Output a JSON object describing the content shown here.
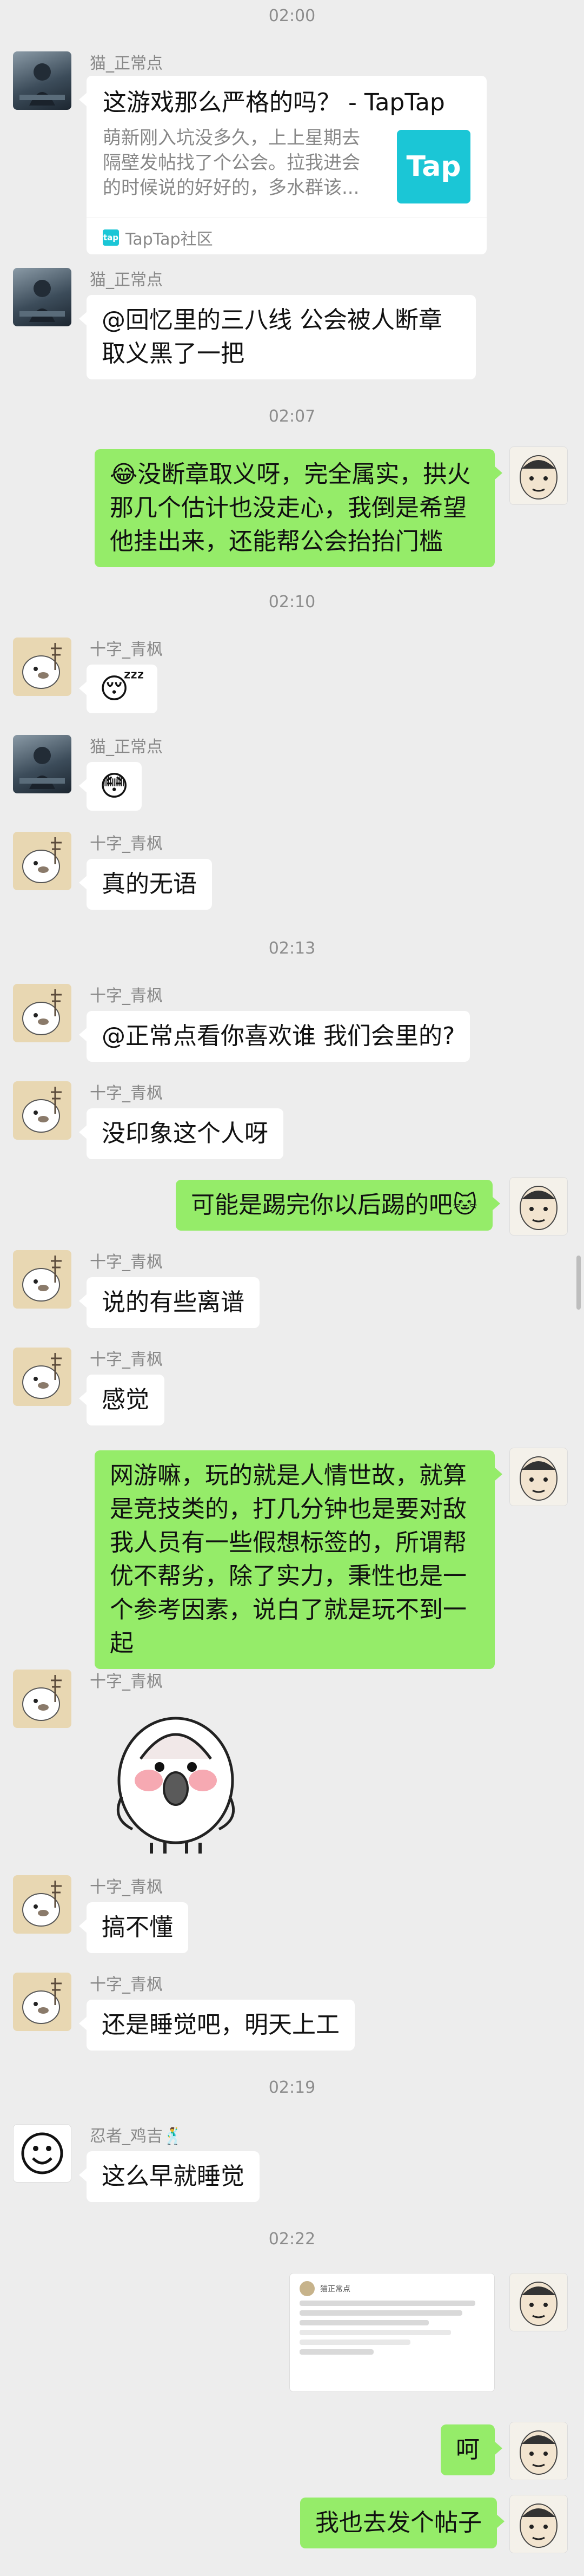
{
  "times": [
    "02:00",
    "02:07",
    "02:10",
    "02:13",
    "02:19",
    "02:22"
  ],
  "users": {
    "cat": "猫_正常点",
    "bird": "十字_青枫",
    "ninja": "忍者_鸡吉🕺"
  },
  "card": {
    "title": "这游戏那么严格的吗？ - TapTap",
    "desc": "萌新刚入坑没多久，上上星期去隔壁发帖找了个公会。拉我进会的时候说的好好的，多水群该...",
    "thumb_text": "Tap",
    "source": "TapTap社区",
    "mini_icon_text": "tap"
  },
  "messages": {
    "m2": "@回忆里的三八线  公会被人断章取义黑了一把",
    "m3": "😂没断章取义呀，完全属实，拱火那几个估计也没走心，我倒是希望他挂出来，还能帮公会抬抬门槛",
    "m4": "😴",
    "m5": "😳",
    "m6": "真的无语",
    "m7": "@正常点看你喜欢谁  我们会里的?",
    "m8": "没印象这个人呀",
    "m9": "可能是踢完你以后踢的吧🐱",
    "m10": "说的有些离谱",
    "m11": "感觉",
    "m12": "网游嘛，玩的就是人情世故，就算是竞技类的，打几分钟也是要对敌我人员有一些假想标签的，所谓帮优不帮劣，除了实力，秉性也是一个参考因素，说白了就是玩不到一起",
    "m14": "搞不懂",
    "m15": "还是睡觉吧，明天上工",
    "m16": "这么早就睡觉",
    "m18": "呵",
    "m19": "我也去发个帖子"
  },
  "screenshot": {
    "header": "猫正常点"
  },
  "colors": {
    "background": "#ededed",
    "self_bubble": "#95ec69",
    "other_bubble": "#ffffff",
    "taptap": "#1bc6d6"
  }
}
